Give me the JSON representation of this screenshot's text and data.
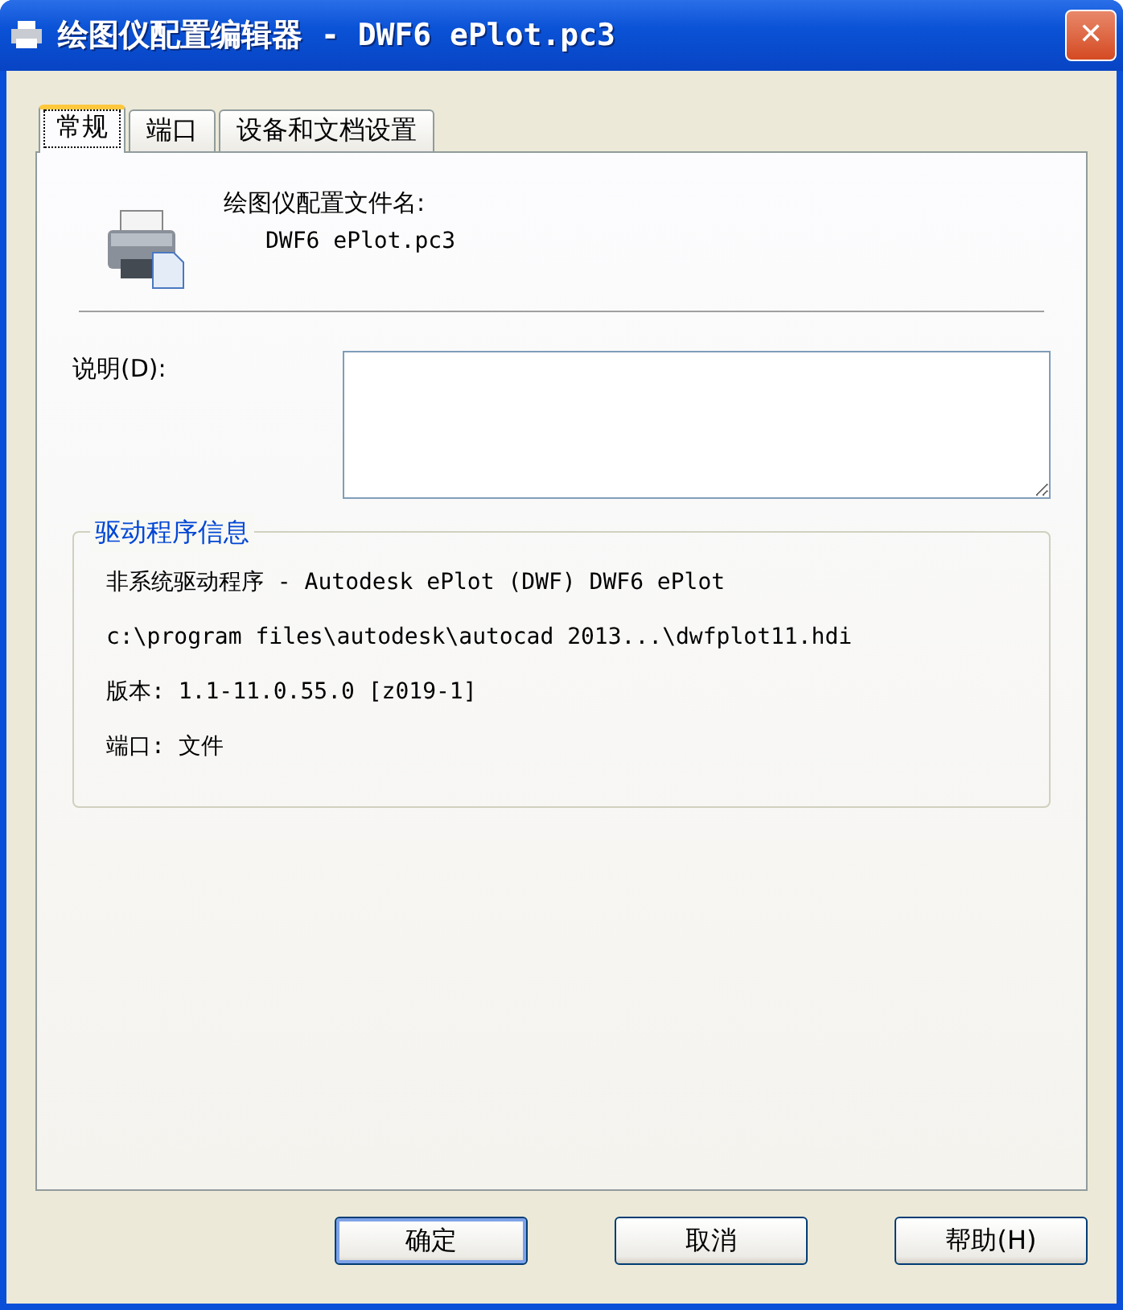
{
  "window": {
    "title": "绘图仪配置编辑器 - DWF6 ePlot.pc3",
    "close": "✕"
  },
  "tabs": [
    {
      "label": "常规",
      "selected": true
    },
    {
      "label": "端口",
      "selected": false
    },
    {
      "label": "设备和文档设置",
      "selected": false
    }
  ],
  "file_name": {
    "label": "绘图仪配置文件名:",
    "value": "DWF6 ePlot.pc3"
  },
  "description": {
    "label": "说明(D):"
  },
  "driver_info": {
    "title": "驱动程序信息",
    "lines": [
      "非系统驱动程序 - Autodesk ePlot (DWF) DWF6 ePlot",
      "c:\\program files\\autodesk\\autocad 2013...\\dwfplot11.hdi",
      "版本: 1.1-11.0.55.0 [z019-1]",
      "端口: 文件"
    ]
  },
  "buttons": [
    {
      "label": "确定",
      "default": true
    },
    {
      "label": "取消",
      "default": false
    },
    {
      "label": "帮助(H)",
      "default": false
    }
  ]
}
